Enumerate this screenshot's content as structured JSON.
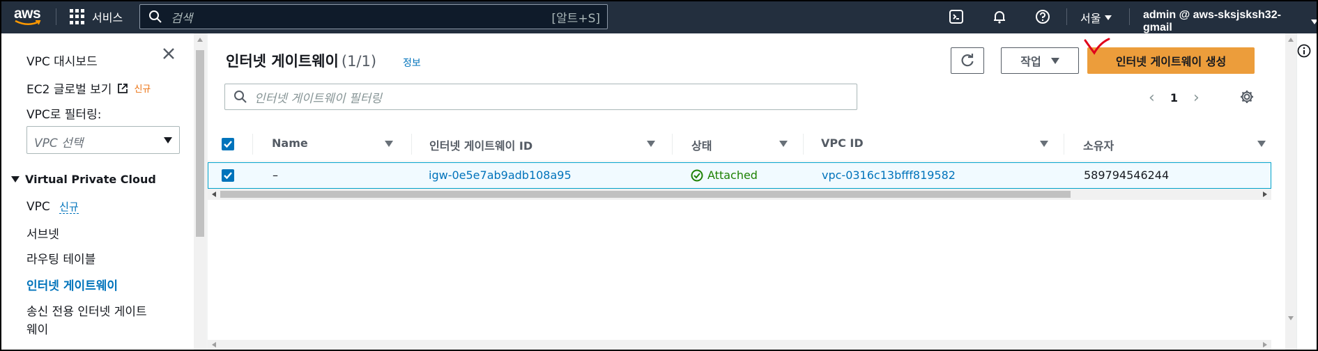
{
  "topnav": {
    "logo": "aws",
    "services_label": "서비스",
    "search_placeholder": "검색",
    "search_shortcut": "[알트+S]",
    "region": "서울",
    "account": "admin @ aws-sksjsksh32-gmail",
    "icons": [
      "grid-icon",
      "search-icon",
      "cloudshell-icon",
      "bell-icon",
      "help-icon"
    ]
  },
  "sidebar": {
    "dashboard": "VPC 대시보드",
    "ec2_global": "EC2 글로벌 보기",
    "ec2_badge": "신규",
    "filter_label": "VPC로 필터링:",
    "filter_placeholder": "VPC 선택",
    "section_title": "Virtual Private Cloud",
    "items": [
      {
        "label": "VPC",
        "badge": "신규"
      },
      {
        "label": "서브넷"
      },
      {
        "label": "라우팅 테이블"
      },
      {
        "label": "인터넷 게이트웨이"
      },
      {
        "label": "송신 전용 인터넷 게이트"
      },
      {
        "label": "웨이"
      }
    ]
  },
  "main": {
    "title": "인터넷 게이트웨이",
    "count": "(1/1)",
    "info": "정보",
    "actions_label": "작업",
    "create_label": "인터넷 게이트웨이 생성",
    "filter_placeholder": "인터넷 게이트웨이 필터링",
    "page": "1",
    "columns": [
      "Name",
      "인터넷 게이트웨이 ID",
      "상태",
      "VPC ID",
      "소유자"
    ],
    "rows": [
      {
        "name": "–",
        "id": "igw-0e5e7ab9adb108a95",
        "status": "Attached",
        "vpc_id": "vpc-0316c13bfff819582",
        "owner": "589794546244"
      }
    ]
  },
  "colors": {
    "nav_bg": "#232f3e",
    "link": "#0073bb",
    "primary": "#ec9d3b",
    "success": "#1d8102",
    "annotation": "#e0001b"
  }
}
